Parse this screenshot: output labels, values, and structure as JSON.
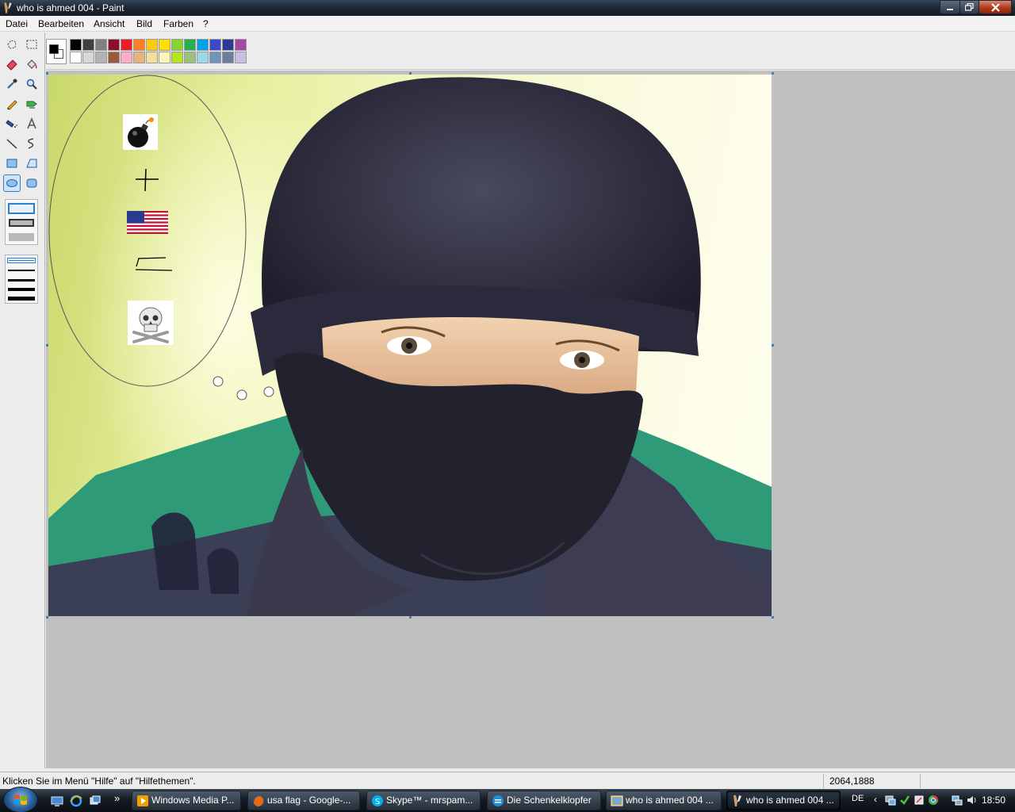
{
  "window": {
    "title": "who is ahmed 004 - Paint",
    "buttons": {
      "minimize": "minimize",
      "maximize": "restore",
      "close": "close"
    }
  },
  "menu": [
    "Datei",
    "Bearbeiten",
    "Ansicht",
    "Bild",
    "Farben",
    "?"
  ],
  "palette": {
    "foreground": "#000000",
    "background": "#ffffff",
    "row1": [
      "#000000",
      "#404040",
      "#808080",
      "#8b0f2a",
      "#ed1c24",
      "#ff7f27",
      "#ffc90e",
      "#ffe000",
      "#8ad42e",
      "#22b14c",
      "#00a2e8",
      "#3f48cc",
      "#2b3a98",
      "#a349a4"
    ],
    "row2": [
      "#ffffff",
      "#d8d8d8",
      "#b4b4b4",
      "#9c5a3c",
      "#ffaec9",
      "#e8b27a",
      "#f5df9a",
      "#fff5b8",
      "#b5e61d",
      "#9bc07a",
      "#99d9ea",
      "#7092be",
      "#6b7f99",
      "#c8bfe7"
    ]
  },
  "tools": [
    "free-form-select",
    "select",
    "eraser",
    "fill",
    "color-picker",
    "magnifier",
    "pencil",
    "brush",
    "airbrush",
    "text",
    "line",
    "curve",
    "rectangle",
    "polygon",
    "ellipse",
    "rounded-rectangle"
  ],
  "active_tool": "ellipse",
  "canvas": {
    "image_description": "photo",
    "selection_shape": "ellipse",
    "thought_bubbles": 3
  },
  "status": {
    "help_text": "Klicken Sie im Menü \"Hilfe\" auf \"Hilfethemen\".",
    "coordinates": "2064,1888"
  },
  "taskbar": {
    "items": [
      {
        "label": "Windows Media P...",
        "icon": "media-player-icon"
      },
      {
        "label": "usa flag - Google-...",
        "icon": "firefox-icon"
      },
      {
        "label": "Skype™ - mrspam...",
        "icon": "skype-icon"
      },
      {
        "label": "Die Schenkelklopfer",
        "icon": "chat-icon"
      },
      {
        "label": "who is ahmed 004 ...",
        "icon": "gallery-icon"
      },
      {
        "label": "who is ahmed 004 ...",
        "icon": "paint-icon"
      }
    ],
    "active_index": 5,
    "language": "DE",
    "clock": "18:50"
  }
}
